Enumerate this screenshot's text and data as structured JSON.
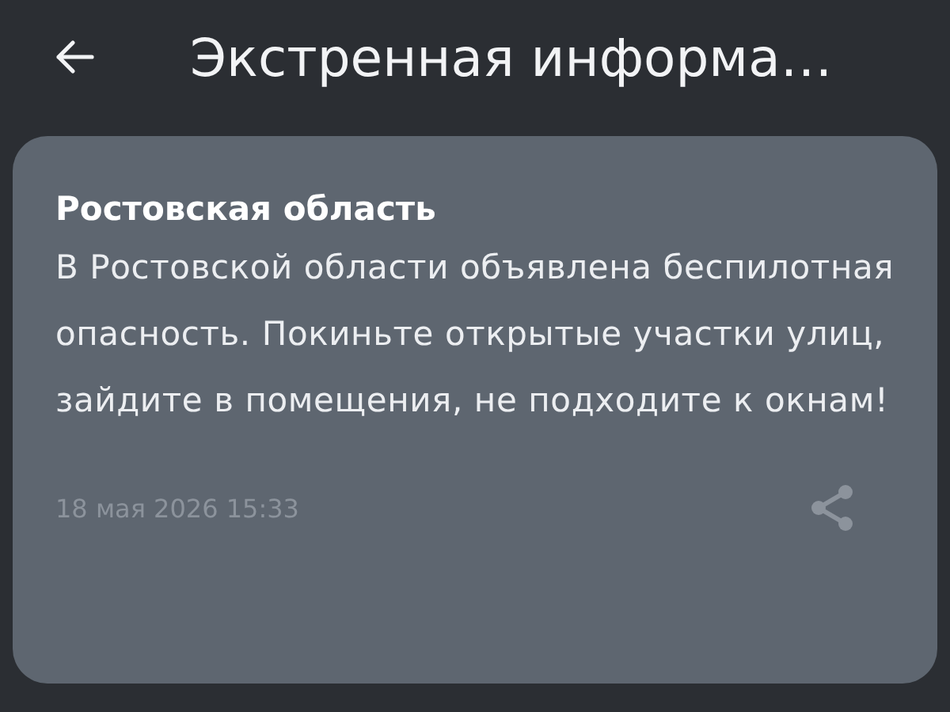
{
  "header": {
    "title": "Экстренная информа…"
  },
  "alert": {
    "region": "Ростовская область",
    "message": "В Ростовской области объявлена беспилотная опасность. Покиньте открытые участки улиц, зайдите в помещения, не подходите к окнам!",
    "time": "18 мая 2026 15:33"
  }
}
